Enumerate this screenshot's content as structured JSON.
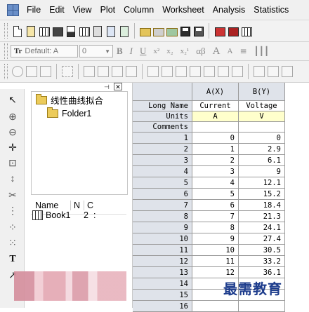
{
  "menubar": {
    "items": [
      "File",
      "Edit",
      "View",
      "Plot",
      "Column",
      "Worksheet",
      "Analysis",
      "Statistics"
    ]
  },
  "format_toolbar": {
    "font_name": "Default: A",
    "font_size": "0",
    "bold": "B",
    "italic": "I",
    "underline": "U",
    "superscript": "x²",
    "subscript": "x₂",
    "supersub": "x₂¹",
    "greek": "αβ",
    "increase_font": "A",
    "decrease_font": "A"
  },
  "explorer": {
    "root_folder": "线性曲线拟合",
    "child_folder": "Folder1",
    "list_headers": [
      "Name",
      "N",
      "C"
    ],
    "items": [
      {
        "name": "Book1",
        "col2": "2",
        "col3": ":"
      }
    ]
  },
  "worksheet": {
    "columns": [
      {
        "header": "A(X)",
        "long_name": "Current",
        "units": "A"
      },
      {
        "header": "B(Y)",
        "long_name": "Voltage",
        "units": "V"
      }
    ],
    "row_labels": [
      "Long Name",
      "Units",
      "Comments"
    ],
    "rows": [
      [
        "0",
        "0"
      ],
      [
        "1",
        "2.9"
      ],
      [
        "2",
        "6.1"
      ],
      [
        "3",
        "9"
      ],
      [
        "4",
        "12.1"
      ],
      [
        "5",
        "15.2"
      ],
      [
        "6",
        "18.4"
      ],
      [
        "7",
        "21.3"
      ],
      [
        "8",
        "24.1"
      ],
      [
        "9",
        "27.4"
      ],
      [
        "10",
        "30.5"
      ],
      [
        "11",
        "33.2"
      ],
      [
        "12",
        "36.1"
      ],
      [
        "",
        ""
      ],
      [
        "",
        ""
      ],
      [
        "",
        ""
      ]
    ]
  },
  "watermark": "最需教育",
  "colors": {
    "accent": "#1d3c8c",
    "header_bg": "#dfe3ea",
    "units_bg": "#ffffcc"
  }
}
